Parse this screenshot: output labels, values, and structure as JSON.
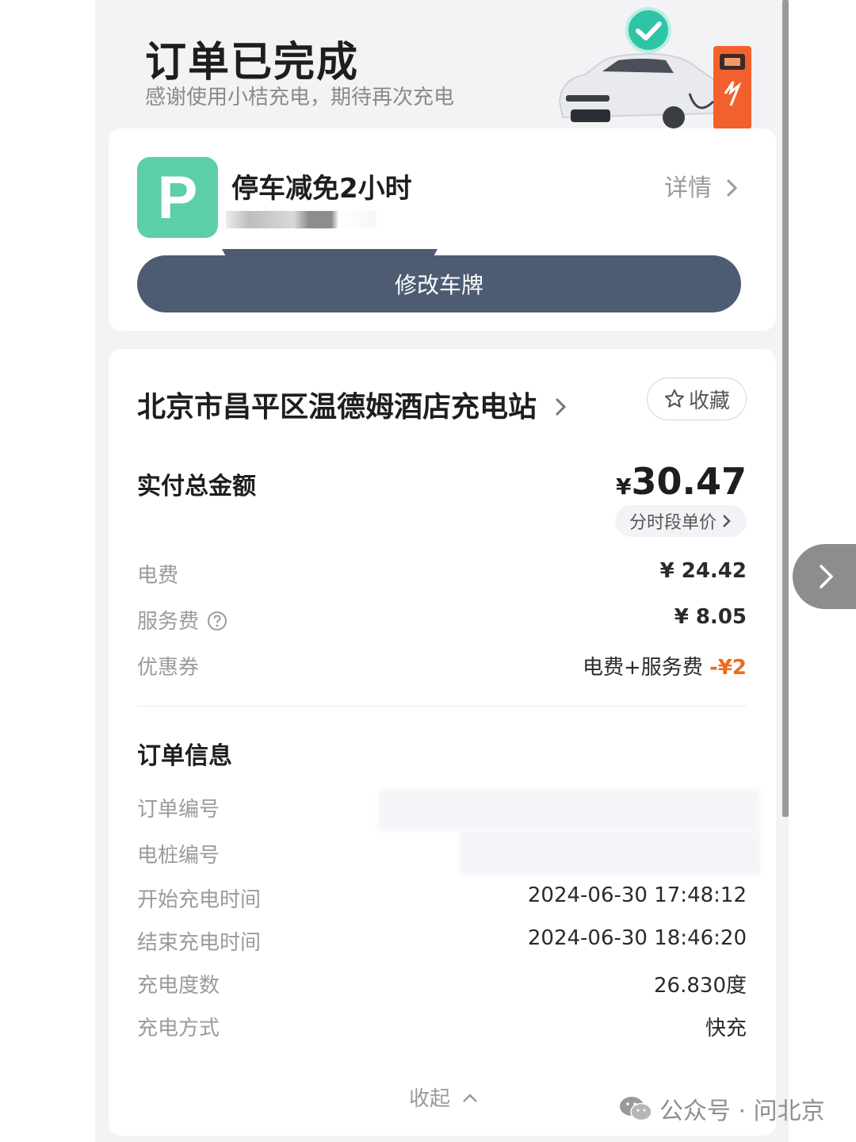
{
  "header": {
    "title": "订单已完成",
    "subtitle": "感谢使用小桔充电，期待再次充电"
  },
  "parking": {
    "icon_letter": "P",
    "title": "停车减免2小时",
    "detail_label": "详情",
    "modify_button": "修改车牌"
  },
  "station": {
    "name": "北京市昌平区温德姆酒店充电站",
    "favorite_label": "收藏"
  },
  "payment": {
    "total_label": "实付总金额",
    "currency": "¥",
    "total_value": "30.47",
    "period_price_label": "分时段单价",
    "items": [
      {
        "label": "电费",
        "value": "¥ 24.42"
      },
      {
        "label": "服务费",
        "value": "¥ 8.05"
      },
      {
        "label": "优惠券",
        "value_prefix": "电费+服务费 ",
        "value": "-¥2"
      }
    ]
  },
  "order_info": {
    "title": "订单信息",
    "rows": [
      {
        "label": "订单编号",
        "value": ""
      },
      {
        "label": "电桩编号",
        "value": ""
      },
      {
        "label": "开始充电时间",
        "value": "2024-06-30 17:48:12"
      },
      {
        "label": "结束充电时间",
        "value": "2024-06-30 18:46:20"
      },
      {
        "label": "充电度数",
        "value": "26.830度"
      },
      {
        "label": "充电方式",
        "value": "快充"
      }
    ],
    "collapse_label": "收起"
  },
  "watermark": {
    "text": "公众号 · 问北京"
  },
  "colors": {
    "accent_dark": "#4d5b73",
    "parking_green": "#5ccfa6",
    "discount_orange": "#ef6a1b",
    "check_teal": "#2ec4a5"
  }
}
